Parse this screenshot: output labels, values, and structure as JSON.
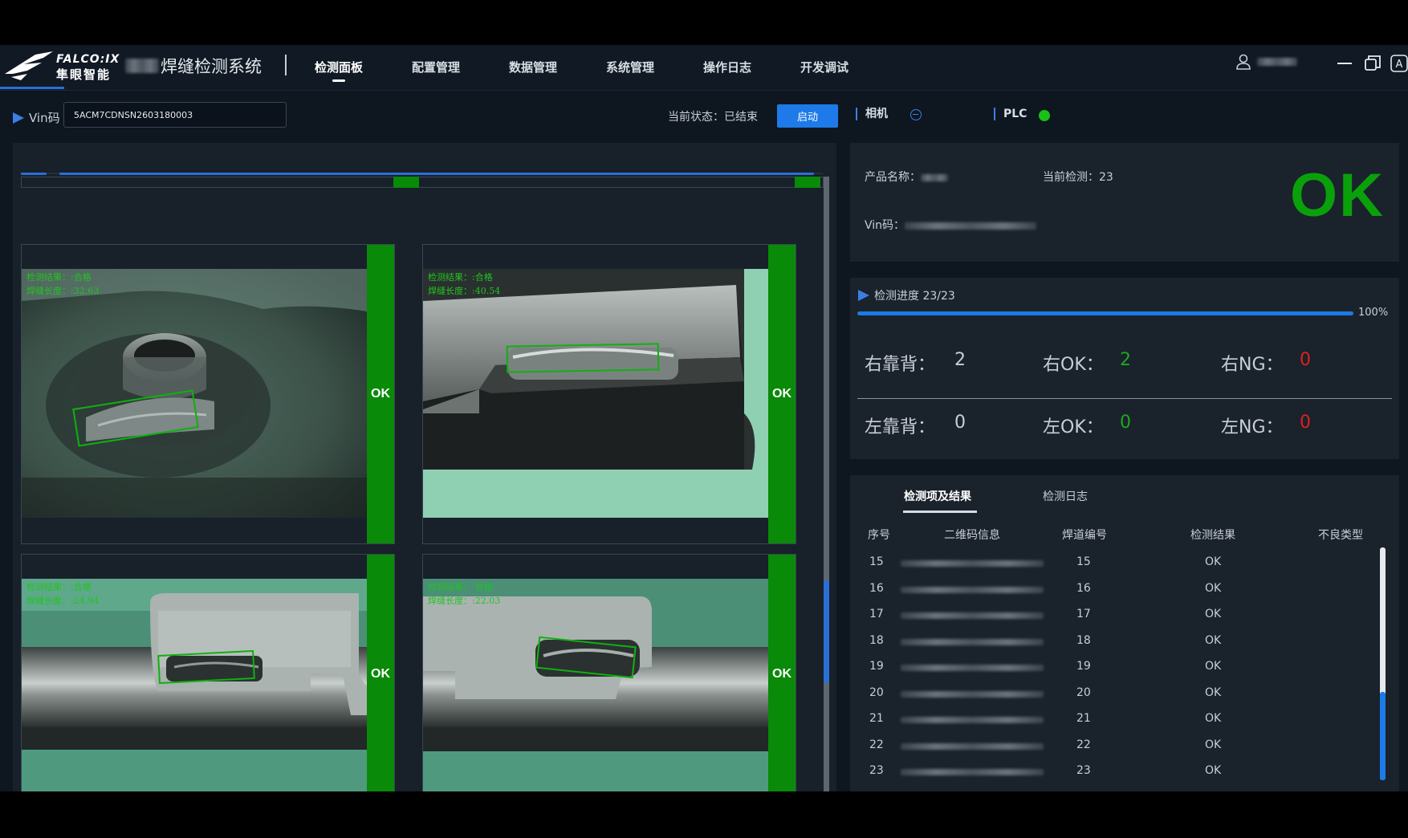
{
  "header": {
    "brand_en": "FALCO:IX",
    "brand_cn": "隼眼智能",
    "app_title": "焊缝检测系统",
    "nav": [
      {
        "label": "检测面板",
        "active": true
      },
      {
        "label": "配置管理",
        "active": false
      },
      {
        "label": "数据管理",
        "active": false
      },
      {
        "label": "系统管理",
        "active": false
      },
      {
        "label": "操作日志",
        "active": false
      },
      {
        "label": "开发调试",
        "active": false
      }
    ],
    "icons": [
      "user-icon",
      "minimize-icon",
      "restore-icon",
      "translate-icon"
    ]
  },
  "toolbar": {
    "vin_label": "Vin码",
    "vin_value": "5ACM7CDNSN2603180003",
    "status_text": "当前状态：已结束",
    "start_button": "启动",
    "camera_label": "相机",
    "plc_label": "PLC",
    "plc_status_color": "#18c018"
  },
  "inspection": {
    "cells": [
      {
        "line1": "检测结果：:合格",
        "line2": "焊缝长度：:32.63",
        "result": "OK"
      },
      {
        "line1": "检测结果：:合格",
        "line2": "焊缝长度：:40.54",
        "result": "OK"
      },
      {
        "line1": "检测结果：:合格",
        "line2": "焊缝长度：:24.94",
        "result": "OK"
      },
      {
        "line1": "检测结果：:合格",
        "line2": "焊缝长度：:22.03",
        "result": "OK"
      }
    ],
    "ok_color": "#098a09"
  },
  "product": {
    "name_label": "产品名称：",
    "current_label": "当前检测：",
    "current_value": "23",
    "vin_label": "Vin码：",
    "result": "OK",
    "result_color": "#0aa00a"
  },
  "progress": {
    "label": "检测进度 23/23",
    "percent": 100,
    "percent_label": "100%",
    "stats": {
      "right_back_label": "右靠背：",
      "right_back": "2",
      "right_ok_label": "右OK：",
      "right_ok": "2",
      "right_ng_label": "右NG：",
      "right_ng": "0",
      "left_back_label": "左靠背：",
      "left_back": "0",
      "left_ok_label": "左OK：",
      "left_ok": "0",
      "left_ng_label": "左NG：",
      "left_ng": "0"
    },
    "ok_color": "#1ea81e",
    "ng_color": "#e0201a"
  },
  "results": {
    "tabs": [
      {
        "label": "检测项及结果",
        "active": true
      },
      {
        "label": "检测日志",
        "active": false
      }
    ],
    "columns": [
      "序号",
      "二维码信息",
      "焊道编号",
      "检测结果",
      "不良类型"
    ],
    "rows": [
      {
        "no": "15",
        "weld": "15",
        "result": "OK"
      },
      {
        "no": "16",
        "weld": "16",
        "result": "OK"
      },
      {
        "no": "17",
        "weld": "17",
        "result": "OK"
      },
      {
        "no": "18",
        "weld": "18",
        "result": "OK"
      },
      {
        "no": "19",
        "weld": "19",
        "result": "OK"
      },
      {
        "no": "20",
        "weld": "20",
        "result": "OK"
      },
      {
        "no": "21",
        "weld": "21",
        "result": "OK"
      },
      {
        "no": "22",
        "weld": "22",
        "result": "OK"
      },
      {
        "no": "23",
        "weld": "23",
        "result": "OK"
      }
    ]
  }
}
